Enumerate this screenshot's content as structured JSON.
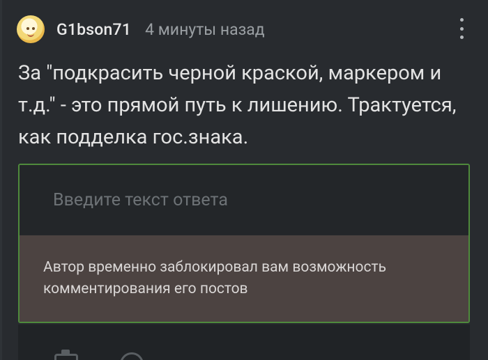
{
  "comment": {
    "username": "G1bson71",
    "timestamp": "4 минуты назад",
    "text": "За \"подкрасить черной краской, маркером и т.д.\" - это прямой путь к лишению. Трактуется, как подделка гос.знака."
  },
  "reply": {
    "placeholder": "Введите текст ответа",
    "blocked_notice": "Автор временно заблокировал вам возможность комментирования его постов"
  },
  "icons": {
    "avatar": "avatar-image",
    "more": "more-vertical-icon",
    "camera": "camera-icon",
    "help": "help-circle-icon"
  },
  "colors": {
    "background": "#282b2f",
    "reply_border": "#4f8a3c",
    "blocked_bg": "#4c4341",
    "muted_text": "#9a9fa3"
  }
}
